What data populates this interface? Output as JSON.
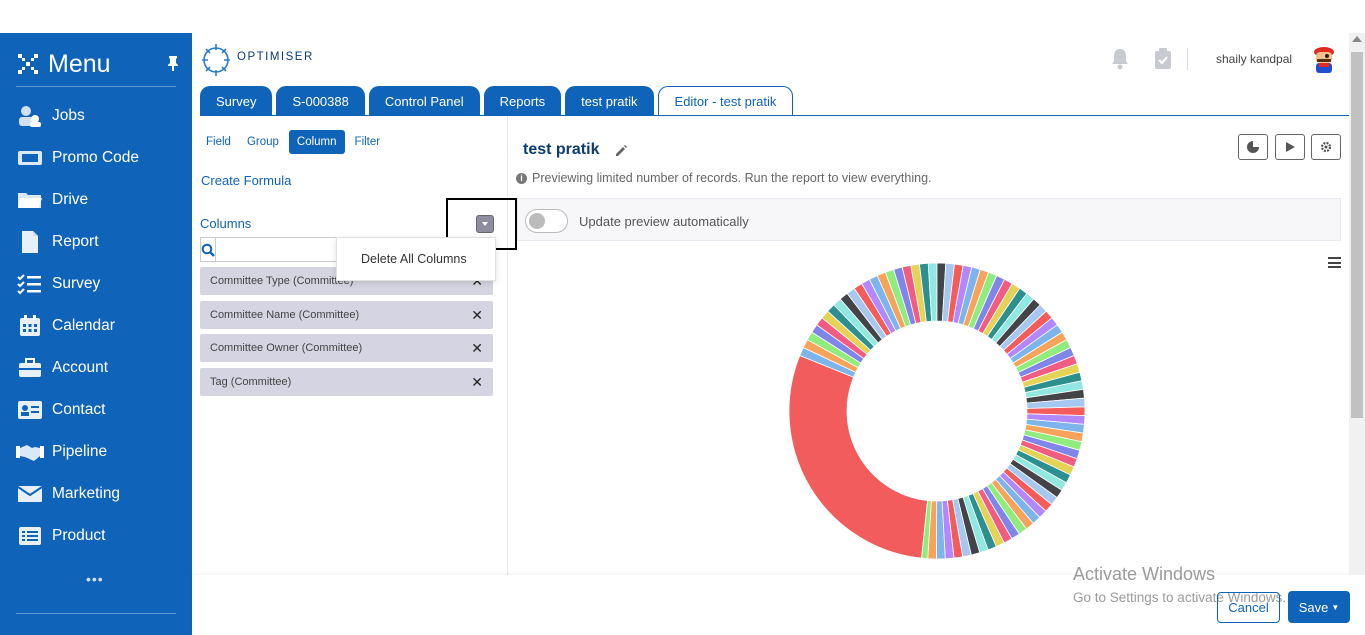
{
  "sidebar": {
    "title": "Menu",
    "items": [
      {
        "label": "Jobs",
        "icon": "users-icon"
      },
      {
        "label": "Promo Code",
        "icon": "ticket-icon"
      },
      {
        "label": "Drive",
        "icon": "folder-icon"
      },
      {
        "label": "Report",
        "icon": "document-icon"
      },
      {
        "label": "Survey",
        "icon": "checklist-icon"
      },
      {
        "label": "Calendar",
        "icon": "calendar-icon"
      },
      {
        "label": "Account",
        "icon": "briefcase-icon"
      },
      {
        "label": "Contact",
        "icon": "id-card-icon"
      },
      {
        "label": "Pipeline",
        "icon": "handshake-icon"
      },
      {
        "label": "Marketing",
        "icon": "envelope-icon"
      },
      {
        "label": "Product",
        "icon": "list-icon"
      }
    ],
    "more": "•••"
  },
  "header": {
    "logo_text": "OPTIMISER",
    "user_name": "shaily kandpal"
  },
  "tabs": [
    {
      "label": "Survey",
      "active": false
    },
    {
      "label": "S-000388",
      "active": false
    },
    {
      "label": "Control Panel",
      "active": false
    },
    {
      "label": "Reports",
      "active": false
    },
    {
      "label": "test pratik",
      "active": false
    },
    {
      "label": "Editor - test pratik",
      "active": true
    }
  ],
  "left_panel": {
    "subtabs": [
      "Field",
      "Group",
      "Column",
      "Filter"
    ],
    "active_subtab": "Column",
    "create_formula": "Create Formula",
    "columns_label": "Columns",
    "search_placeholder": "",
    "dropdown_item": "Delete All Columns",
    "columns": [
      "Committee Type (Committee)",
      "Committee Name (Committee)",
      "Committee Owner (Committee)",
      "Tag (Committee)"
    ]
  },
  "main": {
    "report_title": "test pratik",
    "preview_note": "Previewing limited number of records. Run the report to view everything.",
    "toggle_label": "Update preview automatically",
    "toggle_on": false
  },
  "footer": {
    "cancel": "Cancel",
    "save": "Save",
    "activate_title": "Activate Windows",
    "activate_sub": "Go to Settings to activate Windows."
  },
  "colors": {
    "primary": "#0f63b8",
    "donut_large_slice": "#f25c5c"
  }
}
